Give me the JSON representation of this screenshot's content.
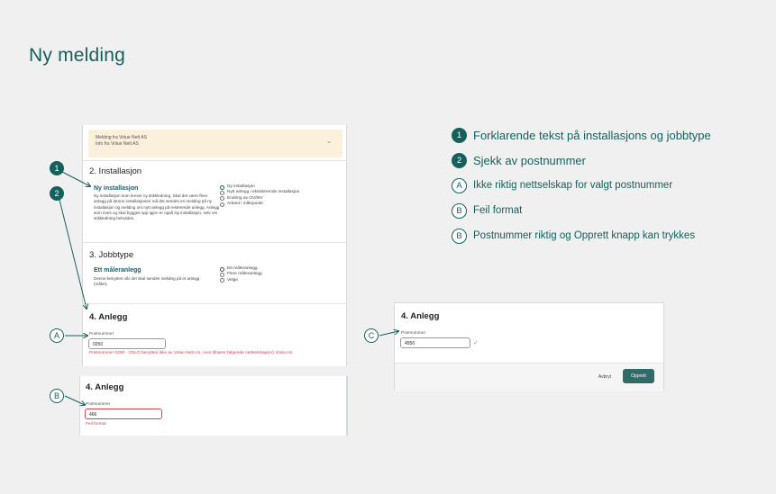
{
  "page": {
    "title": "Ny melding"
  },
  "notice": {
    "line1": "Melding fra Volue Nett AS",
    "line2": "Info fra Volue Nett AS",
    "chevron": "⌄"
  },
  "installasjon": {
    "title": "2. Installasjon",
    "subtitle": "Ny installasjon",
    "description": "Ny installasjon som krever ny stikkledning. Skal det være flere anlegg på denne installasjonen må det sendes en melding på ny installasjon og melding om nytt anlegg på resterende anlegg. Anlegg som rives og skal bygges opp igjen er også Ny installasjon, selv om stikkledning beholdes.",
    "options": [
      {
        "label": "Ny installasjon",
        "selected": true
      },
      {
        "label": "Nytt anlegg i eksisterende installasjon",
        "selected": false
      },
      {
        "label": "Endring av OV/MV",
        "selected": false
      },
      {
        "label": "Arbeid i målepunkt",
        "selected": false
      }
    ]
  },
  "jobbtype": {
    "title": "3. Jobbtype",
    "subtitle": "Ett måleranlegg",
    "description": "Denne benyttes når det skal sendes melding på et anlegg (måler).",
    "options": [
      {
        "label": "Ett måleranlegg",
        "selected": true
      },
      {
        "label": "Flere måleranlegg",
        "selected": false
      },
      {
        "label": "Velge",
        "selected": false
      }
    ]
  },
  "anlegg_a": {
    "title": "4. Anlegg",
    "field_label": "Postnummer",
    "value": "0250",
    "error": "Postnummer 0250 - OSLO benyttes ikke av Volue Nett AS, men tilhører følgende nettselskap(er): Elvia AS."
  },
  "anlegg_b": {
    "title": "4. Anlegg",
    "field_label": "Postnummer",
    "value": "466",
    "error": "Feil format"
  },
  "anlegg_c": {
    "title": "4. Anlegg",
    "field_label": "Postnummer",
    "value": "4550",
    "check": "✓",
    "cancel_label": "Avbryt",
    "create_label": "Opprett"
  },
  "markers": {
    "one": "1",
    "two": "2",
    "a": "A",
    "b": "B",
    "c": "C"
  },
  "legend": [
    {
      "marker": "1",
      "style": "filled",
      "text": "Forklarende tekst på installasjons og jobbtype"
    },
    {
      "marker": "2",
      "style": "filled",
      "text": "Sjekk av postnummer"
    },
    {
      "marker": "A",
      "style": "outline",
      "text": "Ikke riktig nettselskap for valgt postnummer"
    },
    {
      "marker": "B",
      "style": "outline",
      "text": "Feil format"
    },
    {
      "marker": "B",
      "style": "outline",
      "text": "Postnummer riktig og Opprett knapp kan trykkes"
    }
  ],
  "colors": {
    "accent": "#16605c",
    "error": "#c24848",
    "notice_bg": "#fbf0dc",
    "button": "#2f6b67"
  }
}
